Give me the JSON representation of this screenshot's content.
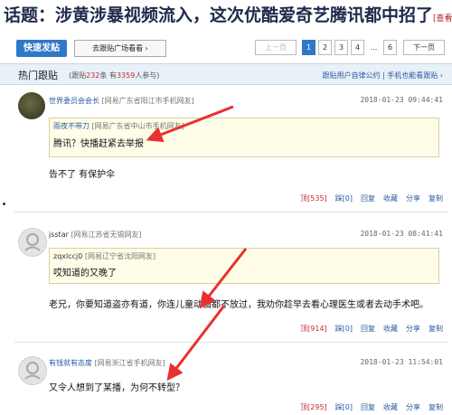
{
  "topic": {
    "headline": "话题：涉黄涉暴视频流入，这次优酷爱奇艺腾讯都中招了",
    "view_original": "[查看原文"
  },
  "toolbar": {
    "post_button": "快速发贴",
    "plaza_button": "去跟贴广场看看 ›",
    "pager": {
      "prev": "上一页",
      "pages": [
        "1",
        "2",
        "3",
        "4",
        "...",
        "6"
      ],
      "current": "1",
      "next": "下一页"
    }
  },
  "hot": {
    "title": "热门跟贴",
    "stats_prefix": "(跟贴",
    "follow_count": "232",
    "stats_mid": "条 有",
    "participant_count": "3359",
    "stats_suffix": "人参与)",
    "link_convention": "跟贴用户自律公约",
    "link_mobile": "手机也能看跟贴 ›"
  },
  "posts": [
    {
      "user": "世界委员会会长",
      "location": "[网易广东省阳江市手机网友]",
      "time": "2018-01-23 09:44:41",
      "quote_user": "雨夜不带刀",
      "quote_location": "[网易广东省中山市手机网友]",
      "quote_text": "腾讯？快播赶紧去举报",
      "text": "告不了 有保护伞",
      "up": "顶[535]",
      "down": "踩[0]",
      "reply": "回复",
      "fav": "收藏",
      "share": "分享",
      "copy": "复制"
    },
    {
      "user": "jsstar",
      "location": "[网易江苏省无锡网友]",
      "time": "2018-01-23 08:41:41",
      "quote_user": "zqxlccj0",
      "quote_location": "[网易辽宁省沈阳网友]",
      "quote_text": "哎知道的又晚了",
      "text": "老兄，你要知道盗亦有道，你连儿童动画都不放过，我劝你趁早去看心理医生或者去动手术吧。",
      "up": "顶[914]",
      "down": "踩[0]",
      "reply": "回复",
      "fav": "收藏",
      "share": "分享",
      "copy": "复制"
    },
    {
      "user": "有钱就有态度",
      "location": "[网易浙江省手机网友]",
      "time": "2018-01-23 11:54:01",
      "text": "又令人想到了某播，为何不转型？",
      "up": "顶[295]",
      "down": "踩[0]",
      "reply": "回复",
      "fav": "收藏",
      "share": "分享",
      "copy": "复制"
    }
  ],
  "colors": {
    "accent": "#2f78c8",
    "link": "#2a5aa0",
    "count_red": "#c03030",
    "quote_bg": "#fffde8",
    "arrow": "#e83030"
  }
}
